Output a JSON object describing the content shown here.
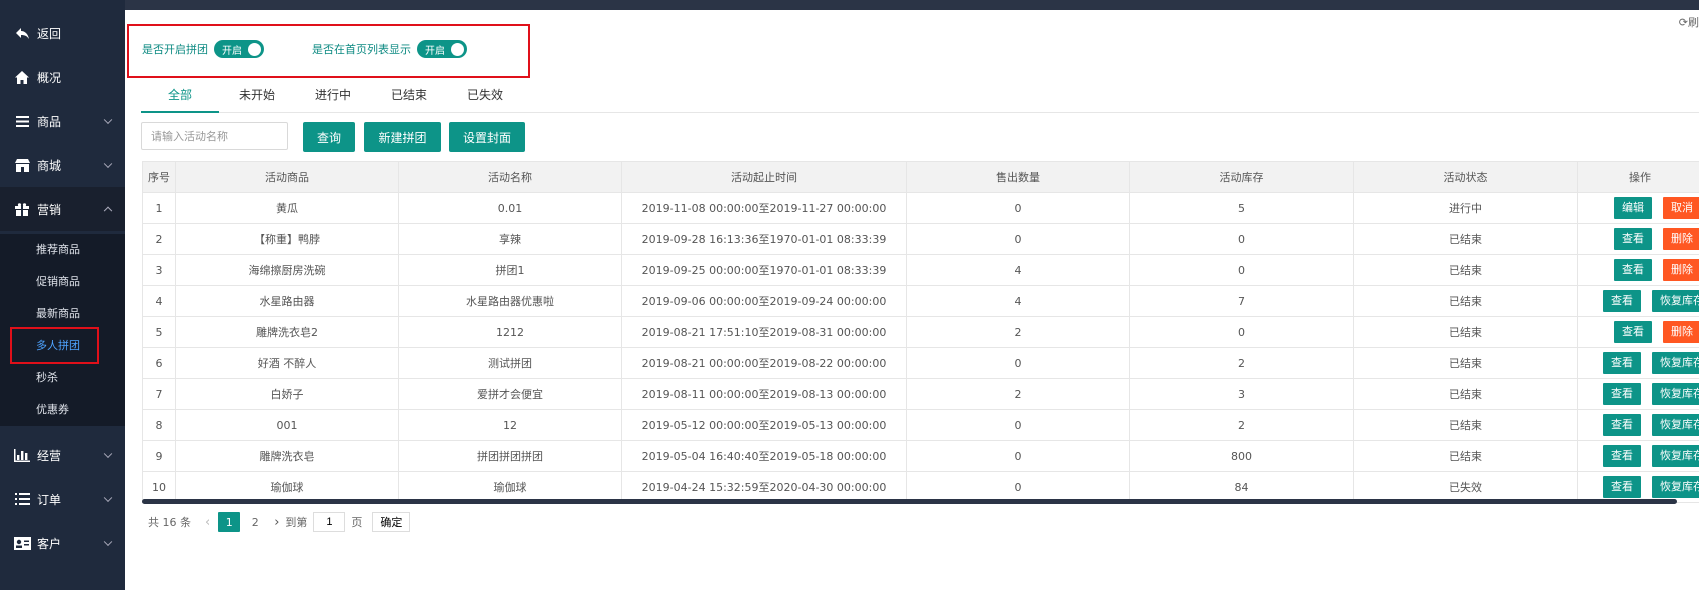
{
  "sidebar": {
    "items": [
      {
        "icon": "back-arrow-icon",
        "label": "返回"
      },
      {
        "icon": "home-icon",
        "label": "概况"
      },
      {
        "icon": "list-icon",
        "label": "商品"
      },
      {
        "icon": "store-icon",
        "label": "商城"
      },
      {
        "icon": "gift-icon",
        "label": "营销"
      },
      {
        "icon": "bar-chart-icon",
        "label": "经营"
      },
      {
        "icon": "list-icon",
        "label": "订单"
      },
      {
        "icon": "id-card-icon",
        "label": "客户"
      }
    ],
    "submenu": [
      "推荐商品",
      "促销商品",
      "最新商品",
      "多人拼团",
      "秒杀",
      "优惠券"
    ],
    "active_sub": "多人拼团"
  },
  "toolbar": {
    "refresh_label": "刷"
  },
  "settings": {
    "enable_group": {
      "label": "是否开启拼团",
      "state": "开启"
    },
    "show_home": {
      "label": "是否在首页列表显示",
      "state": "开启"
    }
  },
  "tabs": [
    "全部",
    "未开始",
    "进行中",
    "已结束",
    "已失效"
  ],
  "search": {
    "placeholder": "请输入活动名称",
    "value": ""
  },
  "buttons": {
    "query": "查询",
    "create": "新建拼团",
    "cover": "设置封面"
  },
  "table": {
    "headers": [
      "序号",
      "活动商品",
      "活动名称",
      "活动起止时间",
      "售出数量",
      "活动库存",
      "活动状态",
      "操作"
    ],
    "rows": [
      {
        "no": "1",
        "product": "黄瓜",
        "name": "0.01",
        "time": "2019-11-08 00:00:00至2019-11-27 00:00:00",
        "sold": "0",
        "stock": "5",
        "status": "进行中",
        "ops": [
          "编辑",
          "取消"
        ]
      },
      {
        "no": "2",
        "product": "【称重】鸭脖",
        "name": "享辣",
        "time": "2019-09-28 16:13:36至1970-01-01 08:33:39",
        "sold": "0",
        "stock": "0",
        "status": "已结束",
        "ops": [
          "查看",
          "删除"
        ]
      },
      {
        "no": "3",
        "product": "海绵擦厨房洗碗",
        "name": "拼团1",
        "time": "2019-09-25 00:00:00至1970-01-01 08:33:39",
        "sold": "4",
        "stock": "0",
        "status": "已结束",
        "ops": [
          "查看",
          "删除"
        ]
      },
      {
        "no": "4",
        "product": "水星路由器",
        "name": "水星路由器优惠啦",
        "time": "2019-09-06 00:00:00至2019-09-24 00:00:00",
        "sold": "4",
        "stock": "7",
        "status": "已结束",
        "ops": [
          "查看",
          "恢复库存"
        ]
      },
      {
        "no": "5",
        "product": "雕牌洗衣皂2",
        "name": "1212",
        "time": "2019-08-21 17:51:10至2019-08-31 00:00:00",
        "sold": "2",
        "stock": "0",
        "status": "已结束",
        "ops": [
          "查看",
          "删除"
        ]
      },
      {
        "no": "6",
        "product": "好酒 不醉人",
        "name": "测试拼团",
        "time": "2019-08-21 00:00:00至2019-08-22 00:00:00",
        "sold": "0",
        "stock": "2",
        "status": "已结束",
        "ops": [
          "查看",
          "恢复库存"
        ]
      },
      {
        "no": "7",
        "product": "白娇子",
        "name": "爱拼才会便宜",
        "time": "2019-08-11 00:00:00至2019-08-13 00:00:00",
        "sold": "2",
        "stock": "3",
        "status": "已结束",
        "ops": [
          "查看",
          "恢复库存"
        ]
      },
      {
        "no": "8",
        "product": "001",
        "name": "12",
        "time": "2019-05-12 00:00:00至2019-05-13 00:00:00",
        "sold": "0",
        "stock": "2",
        "status": "已结束",
        "ops": [
          "查看",
          "恢复库存"
        ]
      },
      {
        "no": "9",
        "product": "雕牌洗衣皂",
        "name": "拼团拼团拼团",
        "time": "2019-05-04 16:40:40至2019-05-18 00:00:00",
        "sold": "0",
        "stock": "800",
        "status": "已结束",
        "ops": [
          "查看",
          "恢复库存"
        ]
      },
      {
        "no": "10",
        "product": "瑜伽球",
        "name": "瑜伽球",
        "time": "2019-04-24 15:32:59至2020-04-30 00:00:00",
        "sold": "0",
        "stock": "84",
        "status": "已失效",
        "ops": [
          "查看",
          "恢复库存"
        ]
      }
    ]
  },
  "pagination": {
    "total": "共 16 条",
    "pages": [
      "1",
      "2"
    ],
    "current": "1",
    "goto_label": "到第",
    "goto_value": "1",
    "page_unit": "页",
    "confirm": "确定"
  }
}
